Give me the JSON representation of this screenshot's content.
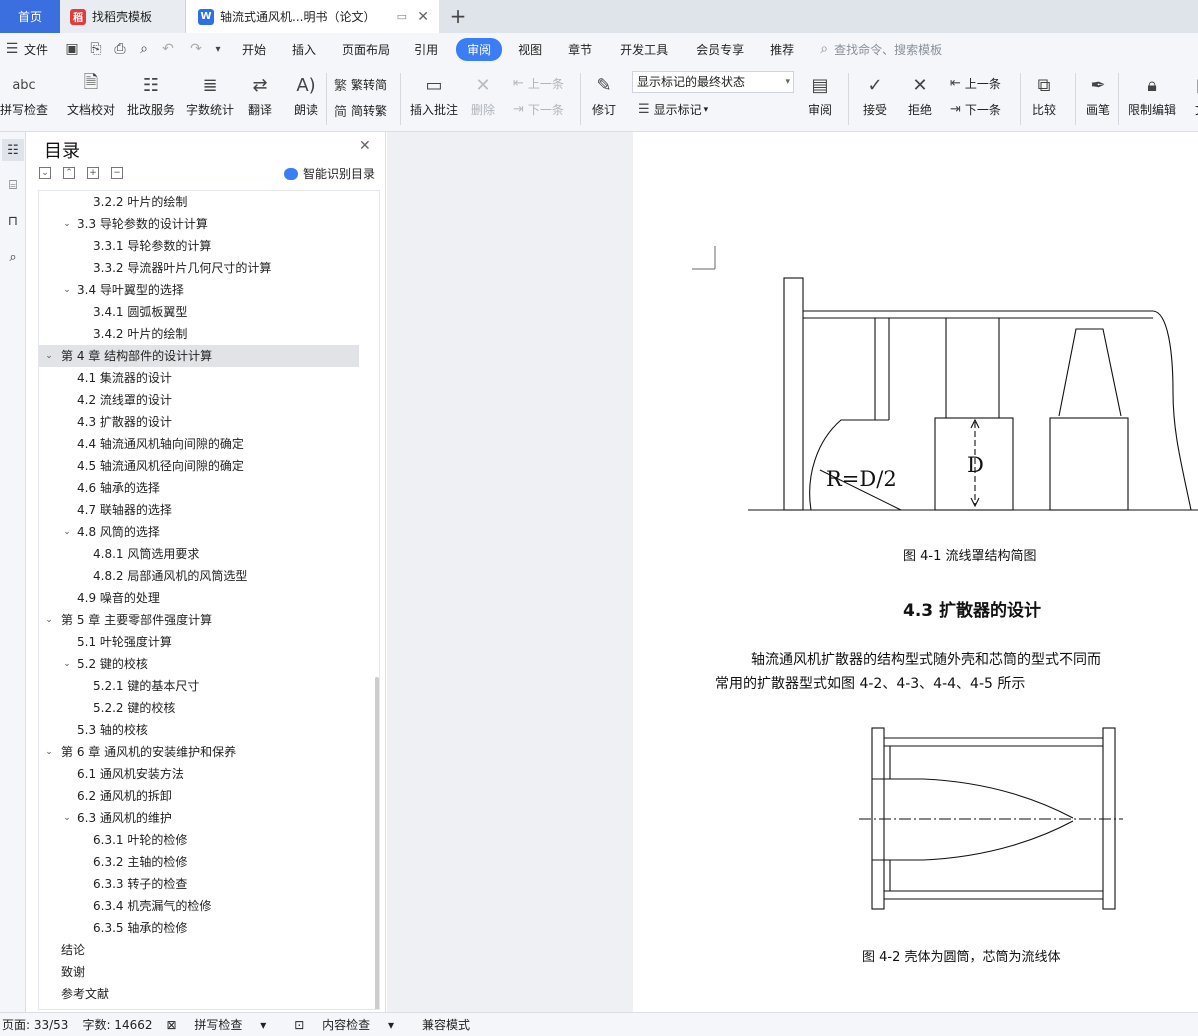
{
  "tabs": {
    "home": "首页",
    "template": "找稻壳模板",
    "doc": "轴流式通风机...明书（论文）",
    "new": "+"
  },
  "menu": {
    "file": "文件",
    "items": [
      "开始",
      "插入",
      "页面布局",
      "引用",
      "审阅",
      "视图",
      "章节",
      "开发工具",
      "会员专享",
      "推荐"
    ],
    "search": "查找命令、搜索模板"
  },
  "toolbar": {
    "spell": "拼写检查",
    "proof": "文档校对",
    "correct": "批改服务",
    "wordcount": "字数统计",
    "translate": "翻译",
    "read": "朗读",
    "trad": "繁转简",
    "simp": "简转繁",
    "comment": "插入批注",
    "delete": "删除",
    "prev": "上一条",
    "next": "下一条",
    "revise": "修订",
    "markup_state": "显示标记的最终状态",
    "show_markup": "显示标记",
    "review": "审阅",
    "accept": "接受",
    "reject": "拒绝",
    "prev2": "上一条",
    "next2": "下一条",
    "compare": "比较",
    "pen": "画笔",
    "restrict": "限制编辑",
    "more": "文"
  },
  "toc": {
    "title": "目录",
    "smart": "智能识别目录",
    "items": [
      {
        "text": "3.2.2 叶片的绘制",
        "level": 3
      },
      {
        "text": "3.3 导轮参数的设计计算",
        "level": 2,
        "toggle": "v"
      },
      {
        "text": "3.3.1 导轮参数的计算",
        "level": 3
      },
      {
        "text": "3.3.2 导流器叶片几何尺寸的计算",
        "level": 3
      },
      {
        "text": "3.4 导叶翼型的选择",
        "level": 2,
        "toggle": "v"
      },
      {
        "text": "3.4.1  圆弧板翼型",
        "level": 3
      },
      {
        "text": "3.4.2 叶片的绘制",
        "level": 3
      },
      {
        "text": "第 4 章  结构部件的设计计算",
        "level": 1,
        "toggle": "v",
        "selected": true
      },
      {
        "text": "4.1 集流器的设计",
        "level": 2
      },
      {
        "text": "4.2 流线罩的设计",
        "level": 2
      },
      {
        "text": "4.3 扩散器的设计",
        "level": 2
      },
      {
        "text": "4.4 轴流通风机轴向间隙的确定",
        "level": 2
      },
      {
        "text": "4.5 轴流通风机径向间隙的确定",
        "level": 2
      },
      {
        "text": "4.6 轴承的选择",
        "level": 2
      },
      {
        "text": "4.7 联轴器的选择",
        "level": 2
      },
      {
        "text": "4.8 风筒的选择",
        "level": 2,
        "toggle": "v"
      },
      {
        "text": "4.8.1 风筒选用要求",
        "level": 3
      },
      {
        "text": "4.8.2 局部通风机的风筒选型",
        "level": 3
      },
      {
        "text": "4.9 噪音的处理",
        "level": 2
      },
      {
        "text": "第 5 章  主要零部件强度计算",
        "level": 1,
        "toggle": "v"
      },
      {
        "text": "5.1 叶轮强度计算",
        "level": 2
      },
      {
        "text": "5.2 键的校核",
        "level": 2,
        "toggle": "v"
      },
      {
        "text": "5.2.1  键的基本尺寸",
        "level": 3
      },
      {
        "text": "5.2.2  键的校核",
        "level": 3
      },
      {
        "text": "5.3 轴的校核",
        "level": 2
      },
      {
        "text": "第 6 章  通风机的安装维护和保养",
        "level": 1,
        "toggle": "v"
      },
      {
        "text": "6.1 通风机安装方法",
        "level": 2
      },
      {
        "text": "6.2 通风机的拆卸",
        "level": 2
      },
      {
        "text": "6.3 通风机的维护",
        "level": 2,
        "toggle": "v"
      },
      {
        "text": "6.3.1 叶轮的检修",
        "level": 3
      },
      {
        "text": "6.3.2 主轴的检修",
        "level": 3
      },
      {
        "text": "6.3.3 转子的检查",
        "level": 3
      },
      {
        "text": "6.3.4 机壳漏气的检修",
        "level": 3
      },
      {
        "text": "6.3.5 轴承的检修",
        "level": 3
      },
      {
        "text": "结论",
        "level": 1
      },
      {
        "text": "致谢",
        "level": 1
      },
      {
        "text": "参考文献",
        "level": 1
      }
    ]
  },
  "document": {
    "fig1_r_label": "R=D/2",
    "fig1_d_label": "D",
    "fig1_caption": "图 4-1  流线罩结构简图",
    "section_heading": "4.3 扩散器的设计",
    "para_line1": "轴流通风机扩散器的结构型式随外壳和芯筒的型式不同而",
    "para_line2": "常用的扩散器型式如图 4-2、4-3、4-4、4-5 所示",
    "fig2_caption": "图 4-2  壳体为圆筒，芯筒为流线体"
  },
  "status": {
    "page": "页面: 33/53",
    "words": "字数: 14662",
    "spell": "拼写检查",
    "content": "内容检查",
    "compat": "兼容模式"
  },
  "colors": {
    "accent": "#3b7df5",
    "home_tab": "#3b6fe0"
  }
}
